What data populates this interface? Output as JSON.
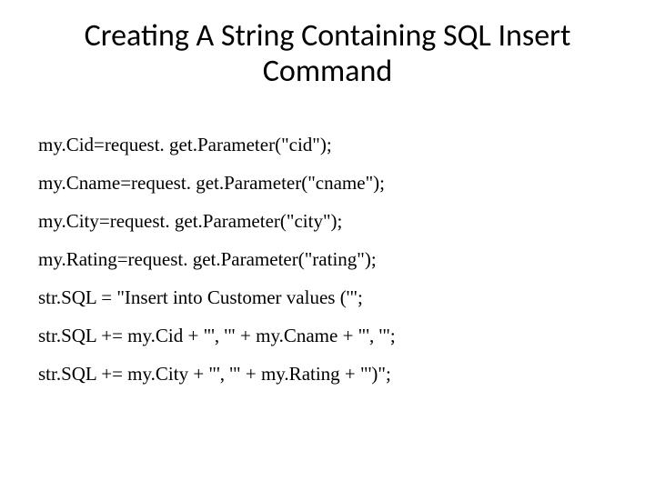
{
  "title": "Creating A String Containing SQL Insert Command",
  "code": {
    "l1": "my.Cid=request. get.Parameter(\"cid\");",
    "l2": "my.Cname=request. get.Parameter(\"cname\");",
    "l3": "my.City=request. get.Parameter(\"city\");",
    "l4": "my.Rating=request. get.Parameter(\"rating\");",
    "l5": "str.SQL = \"Insert into Customer values ('\";",
    "l6": "str.SQL += my.Cid + \"', '\" + my.Cname + \"', '\";",
    "l7": "str.SQL += my.City + \"', '\" + my.Rating + \"')\";"
  }
}
